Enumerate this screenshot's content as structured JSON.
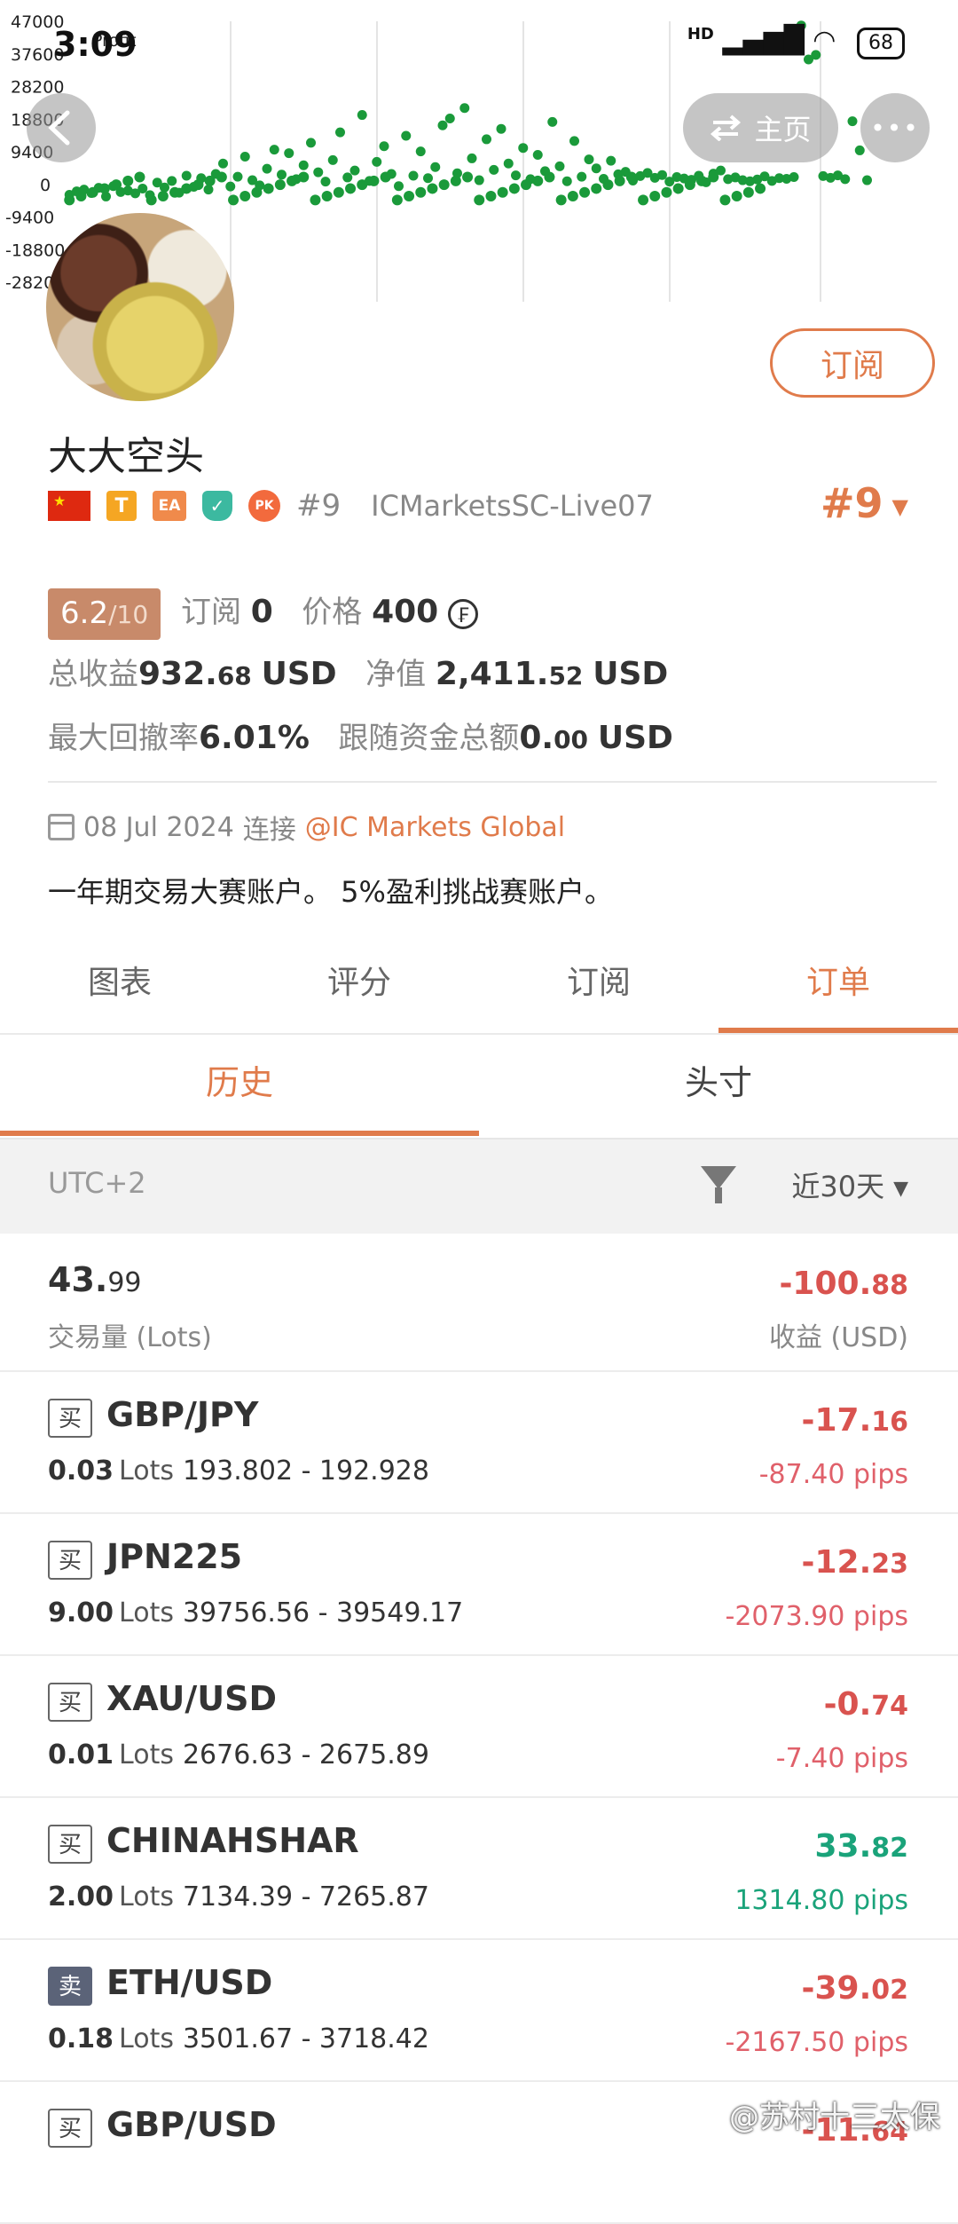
{
  "status_bar": {
    "time": "3:09",
    "signal": "HD",
    "battery": "68"
  },
  "chart": {
    "legend_text": "Profit",
    "y_ticks": [
      "47000",
      "37600",
      "28200",
      "18800",
      "9400",
      "0",
      "-9400",
      "-18800",
      "-28200"
    ],
    "colors": {
      "points": "#1a9a3a"
    }
  },
  "chart_data": {
    "type": "scatter",
    "ylabel": "Profit",
    "ylim": [
      -28200,
      47000
    ],
    "y_ticks": [
      47000,
      37600,
      28200,
      18800,
      9400,
      0,
      -9400,
      -18800,
      -28200
    ],
    "series": [
      {
        "name": "Profit",
        "points": [
          [
            1,
            -3000
          ],
          [
            2,
            -2000
          ],
          [
            3,
            -1500
          ],
          [
            4,
            -2500
          ],
          [
            5,
            -1000
          ],
          [
            6,
            -3500
          ],
          [
            7,
            -500
          ],
          [
            8,
            -2200
          ],
          [
            9,
            -1800
          ],
          [
            10,
            -2600
          ],
          [
            11,
            -1200
          ],
          [
            12,
            -3100
          ],
          [
            13,
            500
          ],
          [
            14,
            -900
          ],
          [
            15,
            1000
          ],
          [
            16,
            -2400
          ],
          [
            17,
            2500
          ],
          [
            18,
            -700
          ],
          [
            19,
            1800
          ],
          [
            20,
            -1500
          ],
          [
            21,
            3000
          ],
          [
            22,
            6000
          ],
          [
            23,
            -600
          ],
          [
            24,
            2200
          ],
          [
            25,
            8000
          ],
          [
            26,
            1200
          ],
          [
            27,
            -300
          ],
          [
            28,
            4500
          ],
          [
            29,
            10000
          ],
          [
            30,
            2800
          ],
          [
            31,
            9000
          ],
          [
            32,
            1500
          ],
          [
            33,
            5500
          ],
          [
            34,
            12000
          ],
          [
            35,
            3500
          ],
          [
            36,
            800
          ],
          [
            37,
            7000
          ],
          [
            38,
            15000
          ],
          [
            39,
            2000
          ],
          [
            40,
            4000
          ],
          [
            41,
            20000
          ],
          [
            42,
            1000
          ],
          [
            43,
            6500
          ],
          [
            44,
            11000
          ],
          [
            45,
            3000
          ],
          [
            46,
            -500
          ],
          [
            47,
            14000
          ],
          [
            48,
            2500
          ],
          [
            49,
            9500
          ],
          [
            50,
            1800
          ],
          [
            51,
            5000
          ],
          [
            52,
            17000
          ],
          [
            53,
            19000
          ],
          [
            54,
            3200
          ],
          [
            55,
            22000
          ],
          [
            56,
            7500
          ],
          [
            57,
            1200
          ],
          [
            58,
            13000
          ],
          [
            59,
            4200
          ],
          [
            60,
            16000
          ],
          [
            61,
            6000
          ],
          [
            62,
            2600
          ],
          [
            63,
            10500
          ],
          [
            64,
            1500
          ],
          [
            65,
            8500
          ],
          [
            66,
            3800
          ],
          [
            67,
            18000
          ],
          [
            68,
            5200
          ],
          [
            69,
            900
          ],
          [
            70,
            12500
          ],
          [
            71,
            2200
          ],
          [
            72,
            7200
          ],
          [
            73,
            4600
          ],
          [
            74,
            1600
          ],
          [
            75,
            6800
          ],
          [
            76,
            2900
          ],
          [
            77,
            3600
          ],
          [
            78,
            1100
          ],
          [
            79,
            2400
          ],
          [
            80,
            3300
          ],
          [
            81,
            1900
          ],
          [
            82,
            2700
          ],
          [
            83,
            800
          ],
          [
            84,
            2100
          ],
          [
            85,
            1700
          ],
          [
            86,
            1300
          ],
          [
            87,
            2500
          ],
          [
            88,
            600
          ],
          [
            89,
            3100
          ],
          [
            90,
            4000
          ],
          [
            91,
            1500
          ],
          [
            92,
            2000
          ],
          [
            93,
            1200
          ],
          [
            94,
            900
          ],
          [
            95,
            1400
          ],
          [
            96,
            2300
          ],
          [
            97,
            1000
          ],
          [
            98,
            1800
          ],
          [
            99,
            1600
          ],
          [
            100,
            2100
          ],
          [
            101,
            45800
          ],
          [
            102,
            36000
          ],
          [
            103,
            37300
          ],
          [
            104,
            2400
          ],
          [
            105,
            1900
          ],
          [
            106,
            2600
          ],
          [
            107,
            1500
          ],
          [
            108,
            18200
          ],
          [
            109,
            9800
          ],
          [
            110,
            1200
          ]
        ]
      }
    ]
  },
  "nav": {
    "home_label": "主页",
    "more_label": "•••"
  },
  "profile": {
    "subscribe_label": "订阅",
    "name": "大大空头",
    "badge_t": "T",
    "badge_ea": "EA",
    "badge_pk": "PK",
    "rank_small": "#9",
    "broker": "ICMarketsSC-Live07",
    "rank_big": "#9"
  },
  "stats": {
    "score": "6.2",
    "score_denom": "/10",
    "subs_label": "订阅",
    "subs_value": "0",
    "price_label": "价格",
    "price_value": "400",
    "price_unit_icon": "₣",
    "total_profit_label": "总收益",
    "total_profit_int": "932.",
    "total_profit_dec": "68",
    "total_profit_unit": "USD",
    "equity_label": "净值",
    "equity_int": "2,411.",
    "equity_dec": "52",
    "equity_unit": "USD",
    "drawdown_label": "最大回撤率",
    "drawdown_value": "6.01%",
    "follow_label": "跟随资金总额",
    "follow_int": "0.",
    "follow_dec": "00",
    "follow_unit": "USD"
  },
  "connection": {
    "date": "08 Jul 2024",
    "connect_label": "连接",
    "broker_link": "@IC Markets Global"
  },
  "description": "一年期交易大赛账户。 5%盈利挑战赛账户。",
  "main_tabs": [
    "图表",
    "评分",
    "订阅",
    "订单"
  ],
  "sub_tabs": [
    "历史",
    "头寸"
  ],
  "filter": {
    "timezone": "UTC+2",
    "period": "近30天"
  },
  "summary": {
    "lots_int": "43.",
    "lots_dec": "99",
    "lots_label": "交易量 (Lots)",
    "profit_int": "-100.",
    "profit_dec": "88",
    "profit_label": "收益 (USD)"
  },
  "orders": [
    {
      "side": "买",
      "sell": false,
      "symbol": "GBP/JPY",
      "lots": "0.03",
      "lots_label": "Lots",
      "prices": "193.802 - 192.928",
      "profit_int": "-17.",
      "profit_dec": "16",
      "pips": "-87.40 pips",
      "positive": false
    },
    {
      "side": "买",
      "sell": false,
      "symbol": "JPN225",
      "lots": "9.00",
      "lots_label": "Lots",
      "prices": "39756.56 - 39549.17",
      "profit_int": "-12.",
      "profit_dec": "23",
      "pips": "-2073.90 pips",
      "positive": false
    },
    {
      "side": "买",
      "sell": false,
      "symbol": "XAU/USD",
      "lots": "0.01",
      "lots_label": "Lots",
      "prices": "2676.63 - 2675.89",
      "profit_int": "-0.",
      "profit_dec": "74",
      "pips": "-7.40 pips",
      "positive": false
    },
    {
      "side": "买",
      "sell": false,
      "symbol": "CHINAHSHAR",
      "lots": "2.00",
      "lots_label": "Lots",
      "prices": "7134.39 - 7265.87",
      "profit_int": "33.",
      "profit_dec": "82",
      "pips": "1314.80 pips",
      "positive": true
    },
    {
      "side": "卖",
      "sell": true,
      "symbol": "ETH/USD",
      "lots": "0.18",
      "lots_label": "Lots",
      "prices": "3501.67 - 3718.42",
      "profit_int": "-39.",
      "profit_dec": "02",
      "pips": "-2167.50 pips",
      "positive": false
    },
    {
      "side": "买",
      "sell": false,
      "symbol": "GBP/USD",
      "lots": "",
      "lots_label": "",
      "prices": "",
      "profit_int": "-11.",
      "profit_dec": "64",
      "pips": "",
      "positive": false
    }
  ],
  "watermark": "@苏村十三太保"
}
